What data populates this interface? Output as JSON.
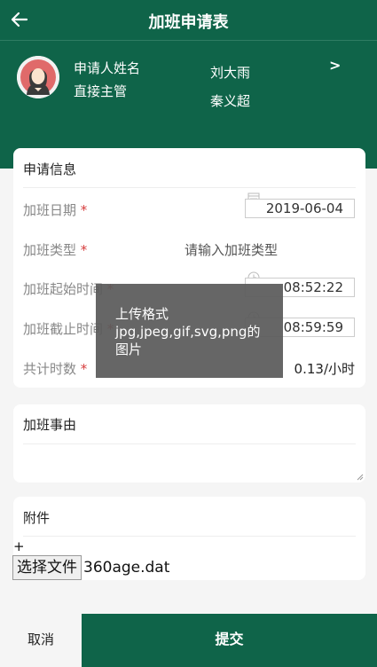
{
  "header": {
    "title": "加班申请表",
    "back_icon": "arrow-left-icon"
  },
  "applicant": {
    "name_label": "申请人姓名",
    "manager_label": "直接主管",
    "name_value": "刘大雨",
    "manager_value": "秦义超",
    "chevron": ">"
  },
  "application": {
    "section_title": "申请信息",
    "date_label": "加班日期",
    "date_value": "2019-06-04",
    "type_label": "加班类型",
    "type_placeholder": "请输入加班类型",
    "start_label": "加班起始时间",
    "start_value": "08:52:22",
    "end_label": "加班截止时间",
    "end_value": "08:59:59",
    "total_label": "共计时数",
    "total_value": "0.13/小时",
    "required_mark": "*"
  },
  "reason": {
    "section_title": "加班事由"
  },
  "attachment": {
    "section_title": "附件",
    "plus": "+",
    "choose_file_label": "选择文件",
    "file_name": "360age.dat"
  },
  "tooltip": {
    "line1": "上传格式",
    "line2": "jpg,jpeg,gif,svg,png的",
    "line3": "图片"
  },
  "footer": {
    "cancel_label": "取消",
    "submit_label": "提交"
  },
  "colors": {
    "brand": "#0f6449",
    "required": "#d63b3b",
    "tooltip_bg": "#5a5a5a"
  }
}
